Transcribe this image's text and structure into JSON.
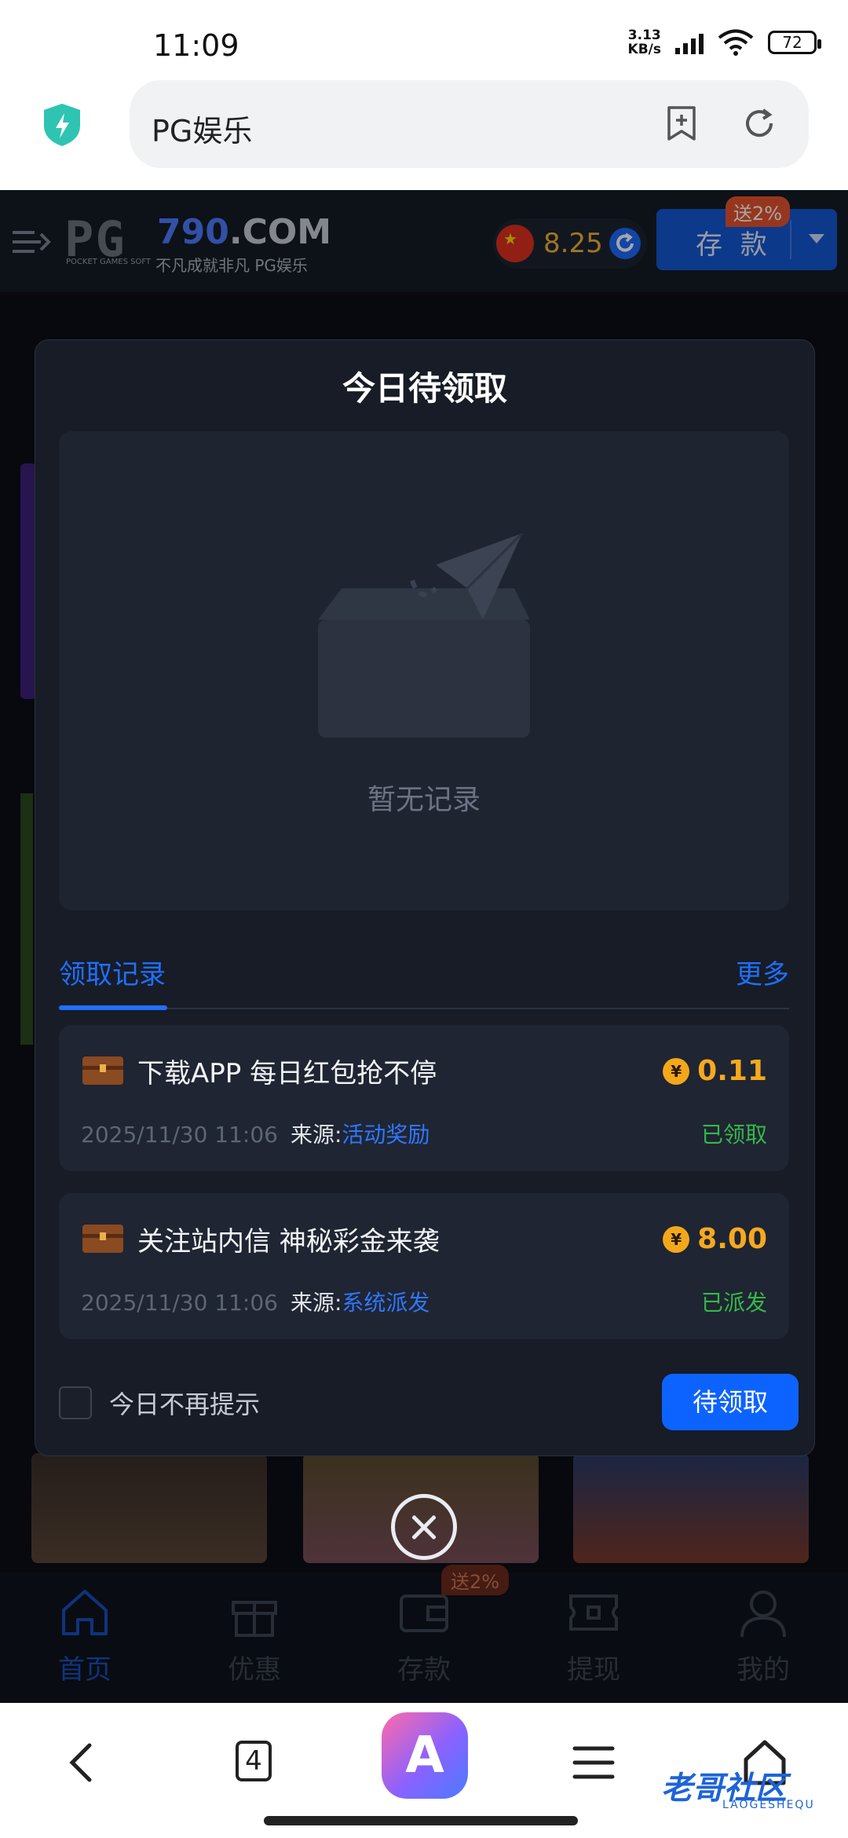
{
  "status_bar": {
    "time": "11:09",
    "net_speed_value": "3.13",
    "net_speed_unit": "KB/s",
    "battery": "72"
  },
  "browser": {
    "url_title": "PG娱乐",
    "tab_count": "4"
  },
  "site_header": {
    "logo_pg": "PG",
    "logo_soft": "POCKET GAMES SOFT",
    "logo_domain_num": "790",
    "logo_domain_rest": ".COM",
    "logo_slogan": "不凡成就非凡 PG娱乐",
    "balance": "8.25",
    "deposit_label": "存 款",
    "deposit_bonus": "送2%"
  },
  "modal": {
    "title": "今日待领取",
    "empty_text": "暂无记录",
    "tab_records": "领取记录",
    "tab_more": "更多",
    "records": [
      {
        "title": "下载APP 每日红包抢不停",
        "amount": "0.11",
        "time": "2025/11/30 11:06",
        "source_label": "来源:",
        "source": "活动奖励",
        "status": "已领取"
      },
      {
        "title": "关注站内信 神秘彩金来袭",
        "amount": "8.00",
        "time": "2025/11/30 11:06",
        "source_label": "来源:",
        "source": "系统派发",
        "status": "已派发"
      }
    ],
    "coin_symbol": "¥",
    "dont_show_label": "今日不再提示",
    "claim_button": "待领取"
  },
  "site_nav": {
    "items": [
      {
        "label": "首页"
      },
      {
        "label": "优惠"
      },
      {
        "label": "存款"
      },
      {
        "label": "提现"
      },
      {
        "label": "我的"
      }
    ],
    "deposit_bonus": "送2%"
  },
  "watermark": {
    "main": "老哥社区",
    "sub": "LAOGESHEQU"
  },
  "colors": {
    "accent": "#1f6fff",
    "gold": "#f5a91f",
    "success": "#35b84a",
    "modal_bg": "#171c26"
  }
}
